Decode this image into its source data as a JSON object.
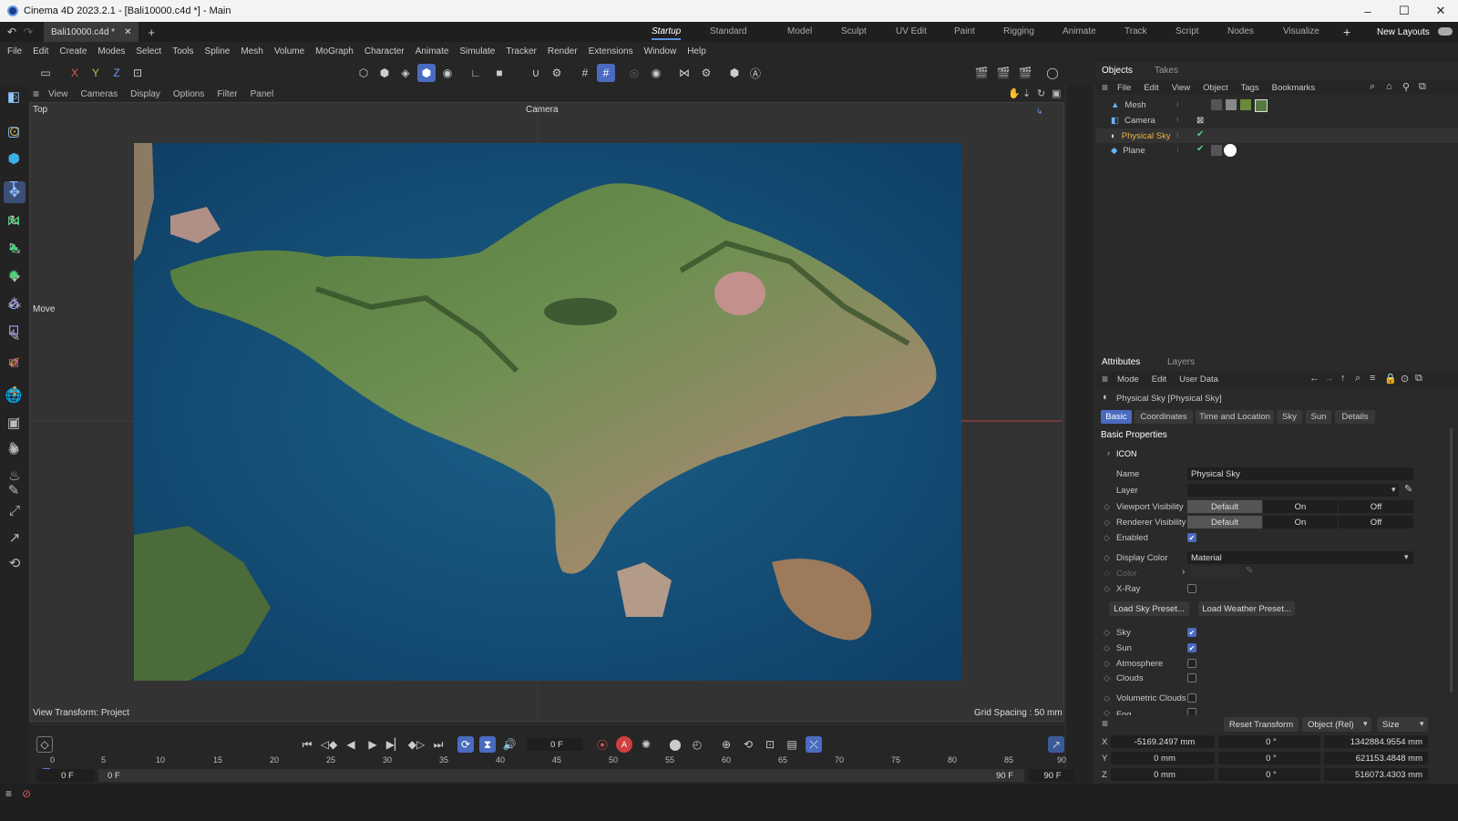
{
  "window": {
    "title": "Cinema 4D 2023.2.1 - [Bali10000.c4d *] - Main",
    "controls": [
      "–",
      "☐",
      "✕"
    ]
  },
  "layout_bar": {
    "doc_tab": "Bali10000.c4d *",
    "tabs": [
      "Startup",
      "Standard",
      "Model",
      "Sculpt",
      "UV Edit",
      "Paint",
      "Rigging",
      "Animate",
      "Track",
      "Script",
      "Nodes",
      "Visualize"
    ],
    "active_tab": "Startup",
    "new_layouts": "New Layouts"
  },
  "menu": [
    "File",
    "Edit",
    "Create",
    "Modes",
    "Select",
    "Tools",
    "Spline",
    "Mesh",
    "Volume",
    "MoGraph",
    "Character",
    "Animate",
    "Simulate",
    "Tracker",
    "Render",
    "Extensions",
    "Window",
    "Help"
  ],
  "toolbar": {
    "axes": [
      "X",
      "Y",
      "Z"
    ]
  },
  "viewport": {
    "menu": [
      "View",
      "Cameras",
      "Display",
      "Options",
      "Filter",
      "Panel"
    ],
    "view_name": "Top",
    "camera_label": "Camera",
    "tool_label": "Move",
    "view_transform": "View Transform: Project",
    "grid_spacing": "Grid Spacing : 50 mm"
  },
  "objects_panel": {
    "tabs": [
      "Objects",
      "Takes"
    ],
    "menu": [
      "File",
      "Edit",
      "View",
      "Object",
      "Tags",
      "Bookmarks"
    ],
    "items": [
      {
        "name": "Mesh",
        "icon": "mesh-icon",
        "selected": false
      },
      {
        "name": "Camera",
        "icon": "camera-icon",
        "selected": false
      },
      {
        "name": "Physical Sky",
        "icon": "sky-icon",
        "selected": true
      },
      {
        "name": "Plane",
        "icon": "plane-icon",
        "selected": false
      }
    ]
  },
  "attributes_panel": {
    "tabs": [
      "Attributes",
      "Layers"
    ],
    "menu": [
      "Mode",
      "Edit",
      "User Data"
    ],
    "object_title": "Physical Sky [Physical Sky]",
    "sub_tabs": [
      "Basic",
      "Coordinates",
      "Time and Location",
      "Sky",
      "Sun",
      "Details"
    ],
    "active_sub_tab": "Basic",
    "section": "Basic Properties",
    "group": "ICON",
    "name_label": "Name",
    "name_value": "Physical Sky",
    "layer_label": "Layer",
    "viewport_visibility_label": "Viewport Visibility",
    "renderer_visibility_label": "Renderer Visibility",
    "vis_options": [
      "Default",
      "On",
      "Off"
    ],
    "enabled_label": "Enabled",
    "display_color_label": "Display Color",
    "display_color_value": "Material",
    "color_label": "Color",
    "xray_label": "X-Ray",
    "load_sky_preset": "Load Sky Preset...",
    "load_weather_preset": "Load Weather Preset...",
    "toggles": [
      {
        "label": "Sky",
        "checked": true
      },
      {
        "label": "Sun",
        "checked": true
      },
      {
        "label": "Atmosphere",
        "checked": false
      },
      {
        "label": "Clouds",
        "checked": false
      }
    ],
    "volumetric_clouds": "Volumetric Clouds",
    "fog": "Fog"
  },
  "coordinates": {
    "reset_transform": "Reset Transform",
    "mode": "Object (Rel)",
    "size": "Size",
    "rows": [
      {
        "axis": "X",
        "pos": "-5169.2497 mm",
        "rot": "0 °",
        "size": "1342884.9554 mm"
      },
      {
        "axis": "Y",
        "pos": "0 mm",
        "rot": "0 °",
        "size": "621153.4848 mm"
      },
      {
        "axis": "Z",
        "pos": "0 mm",
        "rot": "0 °",
        "size": "516073.4303 mm"
      }
    ]
  },
  "timeline": {
    "current_frame": "0 F",
    "ticks": [
      "0",
      "5",
      "10",
      "15",
      "20",
      "25",
      "30",
      "35",
      "40",
      "45",
      "50",
      "55",
      "60",
      "65",
      "70",
      "75",
      "80",
      "85",
      "90"
    ],
    "start_a": "0 F",
    "start_b": "0 F",
    "end_a": "90 F",
    "end_b": "90 F"
  }
}
